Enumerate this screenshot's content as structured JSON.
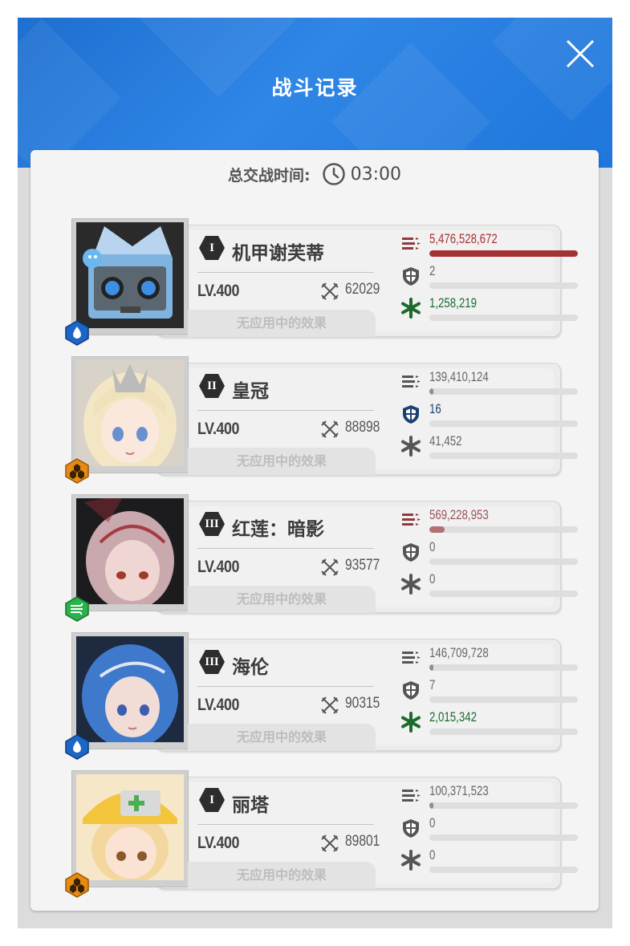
{
  "dialog": {
    "title": "战斗记录",
    "close_icon": "close-icon",
    "total_time_label": "总交战时间:",
    "total_time_value": "03:00"
  },
  "colors": {
    "header_blue": "#1f78dc",
    "damage_red": "#a33234",
    "shield_blue": "#1c3f73",
    "heal_green": "#1b6b2d",
    "neutral_grey": "#555555"
  },
  "characters": [
    {
      "name": "机甲谢芙蒂",
      "burst": "I",
      "level": "LV.400",
      "power": "62029",
      "effects": "无应用中的效果",
      "element": "water-icon",
      "damage": "5,476,528,672",
      "damage_fraction": 1.0,
      "shield": "2",
      "shield_fraction": 0,
      "heal": "1,258,219",
      "heal_fraction": 0,
      "art": "mech"
    },
    {
      "name": "皇冠",
      "burst": "II",
      "level": "LV.400",
      "power": "88898",
      "effects": "无应用中的效果",
      "element": "iron-icon",
      "damage": "139,410,124",
      "damage_fraction": 0.025,
      "shield": "16",
      "shield_fraction": 0,
      "heal": "41,452",
      "heal_fraction": 0,
      "art": "crown"
    },
    {
      "name": "红莲：暗影",
      "burst": "III",
      "level": "LV.400",
      "power": "93577",
      "effects": "无应用中的效果",
      "element": "wind-icon",
      "damage": "569,228,953",
      "damage_fraction": 0.104,
      "shield": "0",
      "shield_fraction": 0,
      "heal": "0",
      "heal_fraction": 0,
      "art": "shadow"
    },
    {
      "name": "海伦",
      "burst": "III",
      "level": "LV.400",
      "power": "90315",
      "effects": "无应用中的效果",
      "element": "water-icon",
      "damage": "146,709,728",
      "damage_fraction": 0.027,
      "shield": "7",
      "shield_fraction": 0,
      "heal": "2,015,342",
      "heal_fraction": 0,
      "art": "helen"
    },
    {
      "name": "丽塔",
      "burst": "I",
      "level": "LV.400",
      "power": "89801",
      "effects": "无应用中的效果",
      "element": "iron-icon",
      "damage": "100,371,523",
      "damage_fraction": 0.018,
      "shield": "0",
      "shield_fraction": 0,
      "heal": "0",
      "heal_fraction": 0,
      "art": "rita"
    }
  ]
}
